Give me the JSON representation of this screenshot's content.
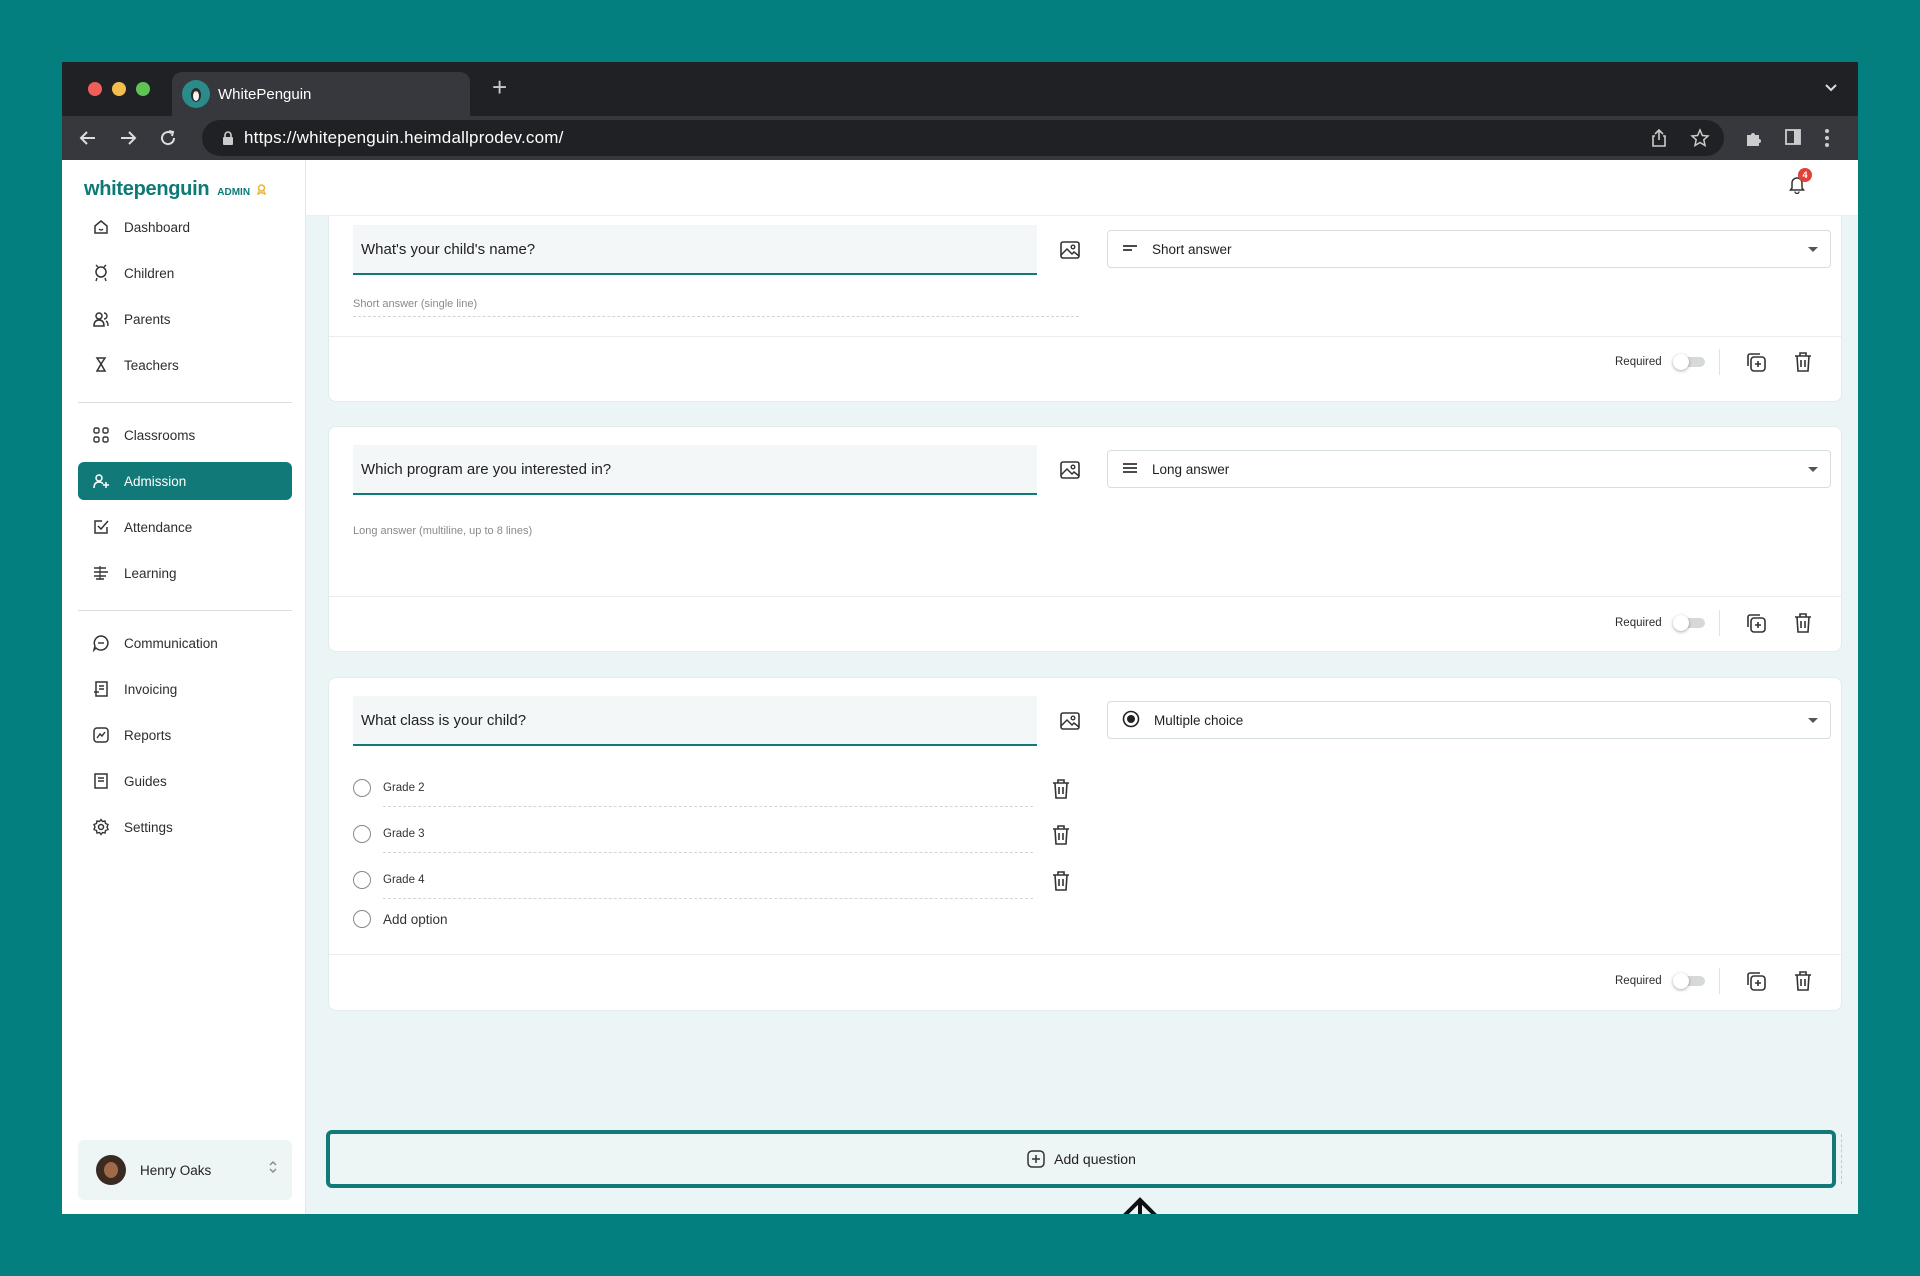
{
  "browser": {
    "tab_title": "WhitePenguin",
    "url": "https://whitepenguin.heimdallprodev.com/",
    "new_tab_symbol": "+"
  },
  "brand": {
    "name": "whitepenguin",
    "role": "ADMIN",
    "accent": "#117a78"
  },
  "sidebar": {
    "items": [
      {
        "label": "Dashboard",
        "icon": "home-icon"
      },
      {
        "label": "Children",
        "icon": "child-icon"
      },
      {
        "label": "Parents",
        "icon": "users-icon"
      },
      {
        "label": "Teachers",
        "icon": "teacher-icon"
      },
      {
        "label": "Classrooms",
        "icon": "grid-icon"
      },
      {
        "label": "Admission",
        "icon": "user-add-icon",
        "active": true
      },
      {
        "label": "Attendance",
        "icon": "check-icon"
      },
      {
        "label": "Learning",
        "icon": "learning-icon"
      },
      {
        "label": "Communication",
        "icon": "chat-icon"
      },
      {
        "label": "Invoicing",
        "icon": "invoice-icon"
      },
      {
        "label": "Reports",
        "icon": "chart-icon"
      },
      {
        "label": "Guides",
        "icon": "book-icon"
      },
      {
        "label": "Settings",
        "icon": "gear-icon"
      }
    ],
    "user": {
      "name": "Henry Oaks"
    }
  },
  "notifications": {
    "count": "4"
  },
  "questions": [
    {
      "question": "What's your child's name?",
      "type": "Short answer",
      "hint": "Short answer (single line)",
      "required_label": "Required",
      "required": false
    },
    {
      "question": "Which program are you interested in?",
      "type": "Long answer",
      "hint": "Long answer (multiline, up to 8 lines)",
      "required_label": "Required",
      "required": false
    },
    {
      "question": "What class is your child?",
      "type": "Multiple choice",
      "options": [
        "Grade 2",
        "Grade 3",
        "Grade 4"
      ],
      "add_option_label": "Add option",
      "required_label": "Required",
      "required": false
    }
  ],
  "add_question_label": "Add question"
}
